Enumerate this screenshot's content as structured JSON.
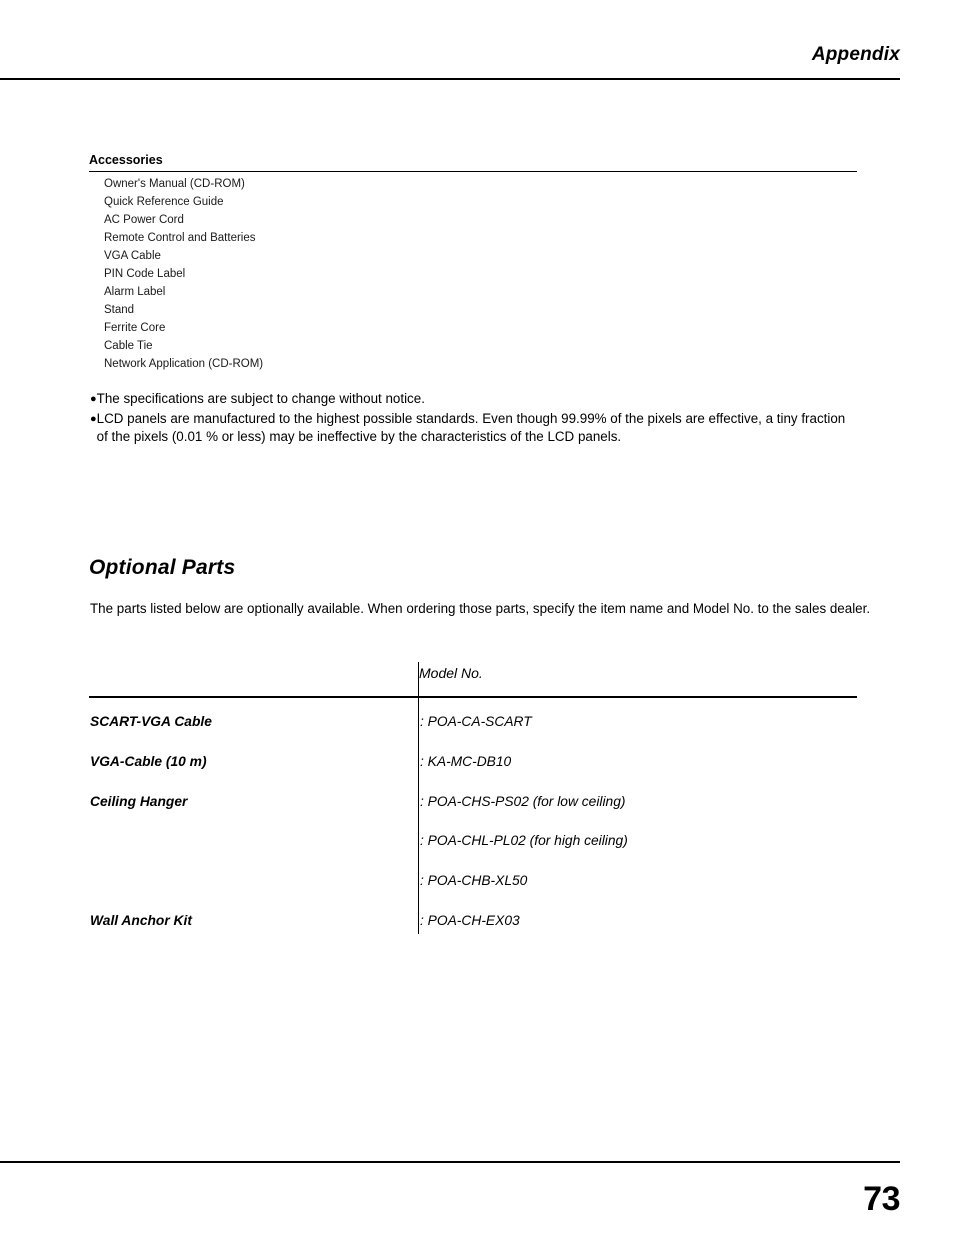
{
  "header": {
    "title": "Appendix"
  },
  "accessories": {
    "heading": "Accessories",
    "items": [
      "Owner's Manual (CD-ROM)",
      "Quick Reference Guide",
      "AC Power Cord",
      "Remote Control and Batteries",
      "VGA Cable",
      "PIN Code Label",
      "Alarm Label",
      "Stand",
      "Ferrite Core",
      "Cable Tie",
      "Network Application (CD-ROM)"
    ]
  },
  "notes": {
    "bullet": "●",
    "items": [
      "The specifications are subject to change without notice.",
      "LCD panels are manufactured to the highest possible standards.  Even though 99.99% of the pixels are effective, a tiny fraction of the pixels (0.01 % or less) may be ineffective by the characteristics of the LCD panels."
    ]
  },
  "optional_parts": {
    "title": "Optional Parts",
    "intro": "The parts listed below are optionally available. When ordering those parts, specify the item name and Model No. to the sales dealer.",
    "column_header": "Model No.",
    "rows": [
      {
        "name": "SCART-VGA Cable",
        "model": ": POA-CA-SCART"
      },
      {
        "name": "VGA-Cable (10 m)",
        "model": ": KA-MC-DB10"
      },
      {
        "name": "Ceiling Hanger",
        "model": ": POA-CHS-PS02 (for low ceiling)"
      },
      {
        "name": "",
        "model": ": POA-CHL-PL02 (for high ceiling)"
      },
      {
        "name": "",
        "model": ": POA-CHB-XL50"
      },
      {
        "name": "Wall Anchor Kit",
        "model": ": POA-CH-EX03"
      }
    ]
  },
  "footer": {
    "page_number": "73"
  }
}
